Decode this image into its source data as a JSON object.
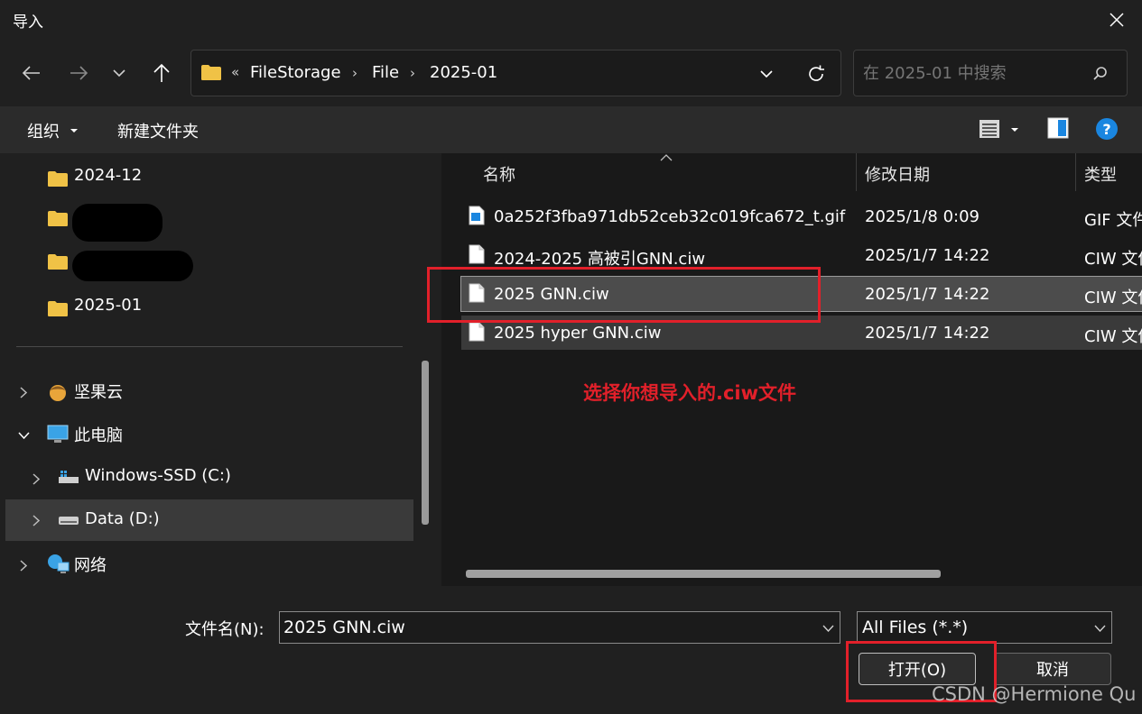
{
  "window": {
    "title": "导入"
  },
  "address": {
    "crumbs": [
      "FileStorage",
      "File",
      "2025-01"
    ],
    "overflow": "«"
  },
  "search": {
    "placeholder": "在 2025-01 中搜索"
  },
  "command_bar": {
    "organize": "组织",
    "new_folder": "新建文件夹"
  },
  "nav_pane": {
    "folders": [
      "2024-12",
      "",
      "",
      "2025-01"
    ],
    "tree": [
      {
        "label": "坚果云",
        "icon": "nutstore-icon"
      },
      {
        "label": "此电脑",
        "icon": "computer-icon"
      },
      {
        "label": "Windows-SSD (C:)",
        "icon": "drive-icon"
      },
      {
        "label": "Data (D:)",
        "icon": "drive-icon"
      },
      {
        "label": "网络",
        "icon": "network-icon"
      }
    ]
  },
  "file_list": {
    "columns": [
      "名称",
      "修改日期",
      "类型"
    ],
    "rows": [
      {
        "name": "0a252f3fba971db52ceb32c019fca672_t.gif",
        "date": "2025/1/8 0:09",
        "type": "GIF 文件",
        "icon": "image-file-icon"
      },
      {
        "name": "2024-2025 高被引GNN.ciw",
        "date": "2025/1/7 14:22",
        "type": "CIW 文件",
        "icon": "file-icon"
      },
      {
        "name": "2025 GNN.ciw",
        "date": "2025/1/7 14:22",
        "type": "CIW 文件",
        "icon": "file-icon"
      },
      {
        "name": "2025 hyper GNN.ciw",
        "date": "2025/1/7 14:22",
        "type": "CIW 文件",
        "icon": "file-icon"
      }
    ],
    "annotation": "选择你想导入的.ciw文件"
  },
  "bottom": {
    "filename_label": "文件名(N):",
    "filename_value": "2025 GNN.ciw",
    "filter_value": "All Files (*.*)",
    "open_button": "打开(O)",
    "cancel_button": "取消",
    "watermark": "CSDN @Hermione Qu"
  },
  "colors": {
    "annotation_red": "#e2202a",
    "folder_yellow": "#f0c246",
    "help_blue": "#1a86e0"
  }
}
